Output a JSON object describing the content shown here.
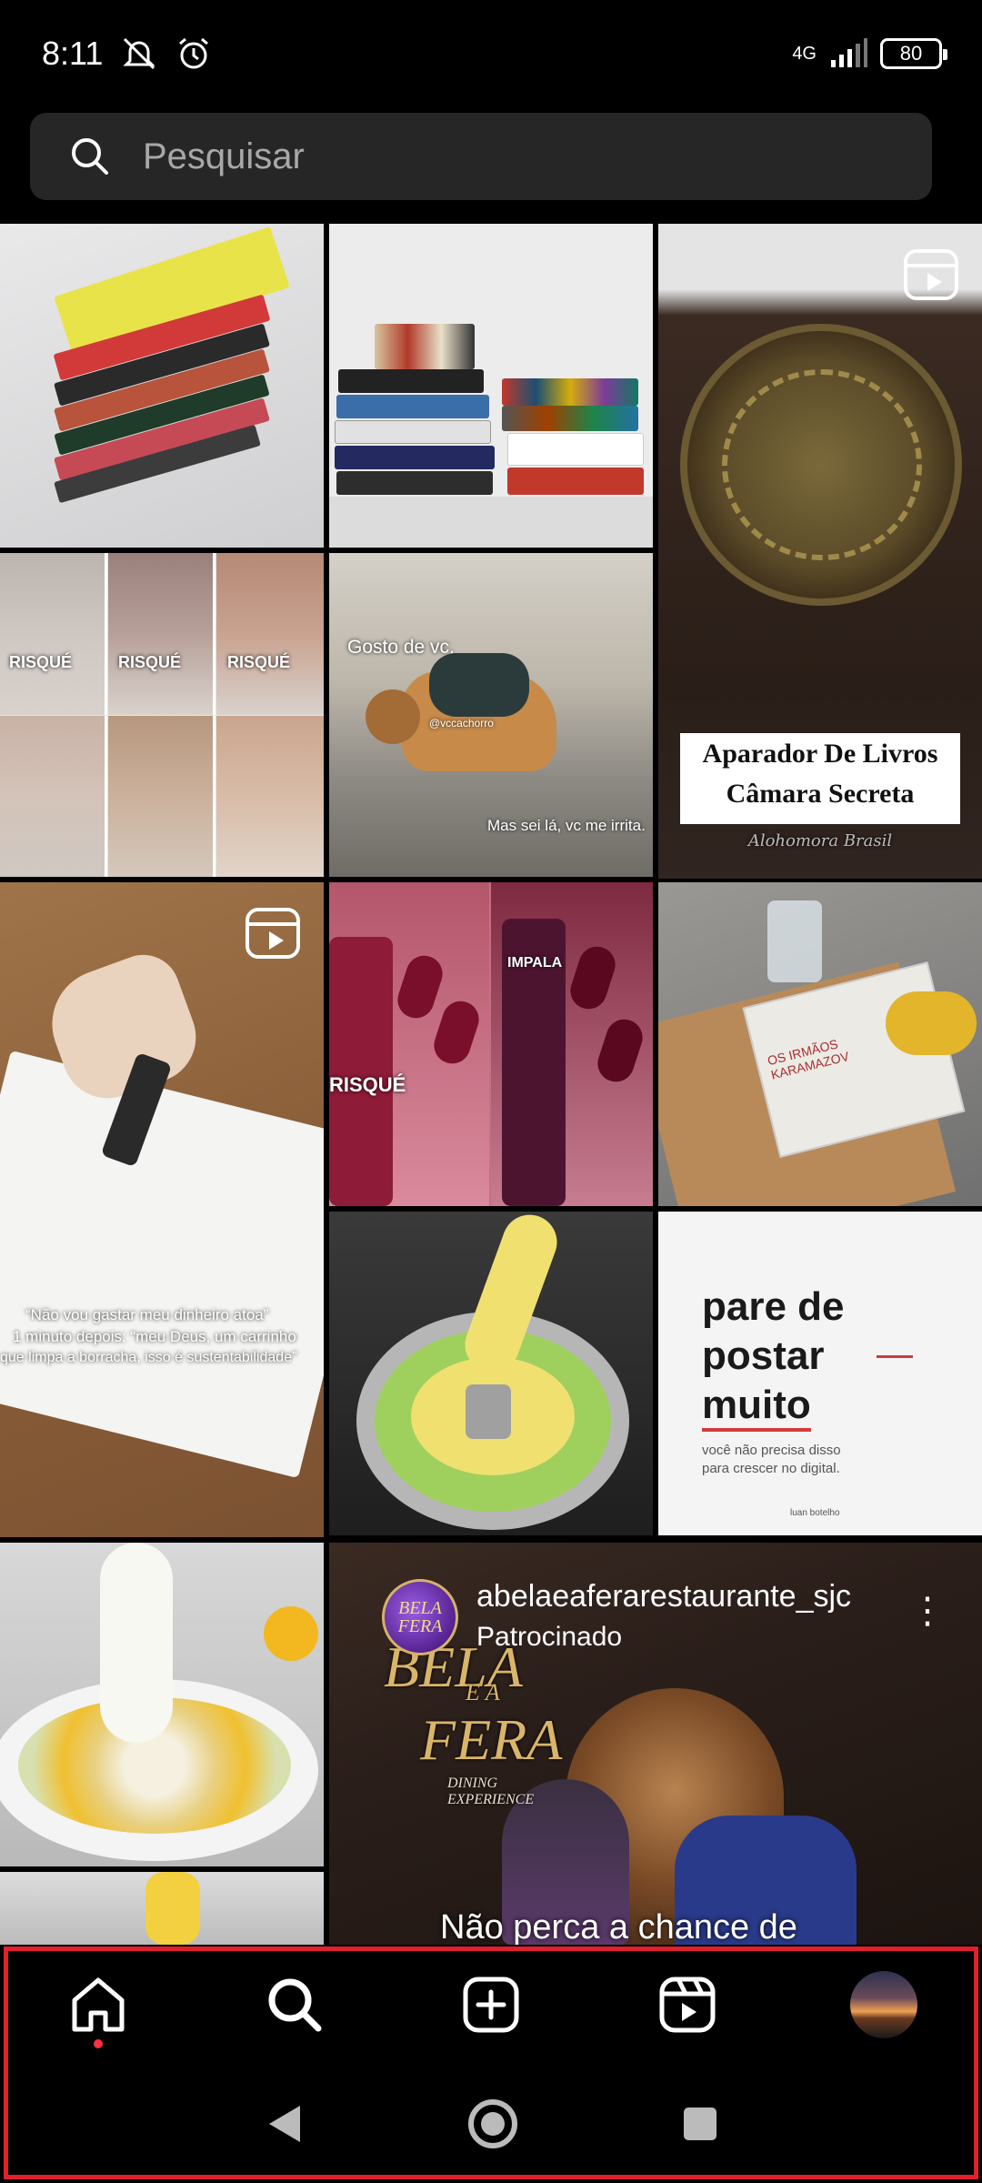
{
  "status_bar": {
    "time": "8:11",
    "network": "4G",
    "battery": "80",
    "icons": [
      "mute-icon",
      "alarm-icon",
      "signal-icon"
    ]
  },
  "search": {
    "placeholder": "Pesquisar"
  },
  "grid": {
    "captions": {
      "dog_top": "Gosto de vc.",
      "dog_bottom": "Mas sei lá, vc me irrita.",
      "dog_handle": "@vccachorro",
      "bookend_title_1": "Aparador De Livros",
      "bookend_title_2": "Câmara Secreta",
      "bookend_brand": "Alohomora Brasil",
      "notebook_1": "“Não vou gastar meu dinheiro atoa”",
      "notebook_2": "1 minuto depois: “meu Deus, um carrinho",
      "notebook_3": "que limpa a borracha, isso é sustentabilidade”",
      "post_1": "pare de",
      "post_2": "postar",
      "post_3": "muito",
      "post_sub_1": "você não precisa disso",
      "post_sub_2": "para crescer no digital.",
      "post_author": "luan botelho",
      "nail_brand": "RISQUÉ",
      "polish_brand": "IMPALA",
      "karamazov": "OS IRMÃOS KARAMAZOV"
    },
    "ad": {
      "username": "abelaeaferarestaurante_sjc",
      "sponsored": "Patrocinado",
      "avatar_text": "BELA FERA",
      "logo_1": "BELA",
      "logo_2": "E A",
      "logo_3": "FERA",
      "logo_sub": "DINING EXPERIENCE",
      "caption": "Não perca a chance de",
      "more_icon": "⋮"
    }
  },
  "bottom_nav": {
    "items": [
      "home-icon",
      "search-icon",
      "create-icon",
      "reels-icon",
      "profile-avatar"
    ],
    "active": "home",
    "notification_color": "#ff3040"
  },
  "android_nav": [
    "back-icon",
    "home-circle-icon",
    "recents-icon"
  ],
  "highlight_color": "#e0202a"
}
